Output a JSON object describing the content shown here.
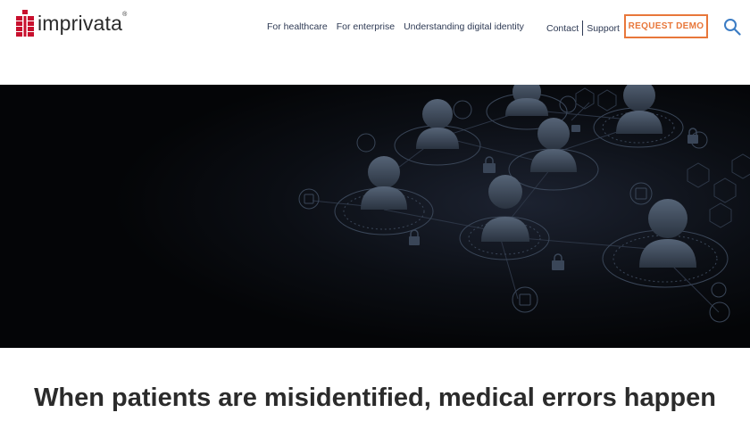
{
  "brand": {
    "name": "imprivata",
    "registered": "®",
    "color": "#c8102e"
  },
  "nav": {
    "items": [
      {
        "label": "For healthcare"
      },
      {
        "label": "For enterprise"
      },
      {
        "label": "Understanding digital identity"
      }
    ]
  },
  "utility": {
    "contact": "Contact",
    "support": "Support"
  },
  "cta": {
    "label": "REQUEST DEMO",
    "color": "#e8773a"
  },
  "search": {
    "icon": "search-icon",
    "color": "#3b7cc4"
  },
  "hero": {
    "image": "network-of-people-icons",
    "background": "#040507"
  },
  "headline": "When patients are misidentified, medical errors happen"
}
